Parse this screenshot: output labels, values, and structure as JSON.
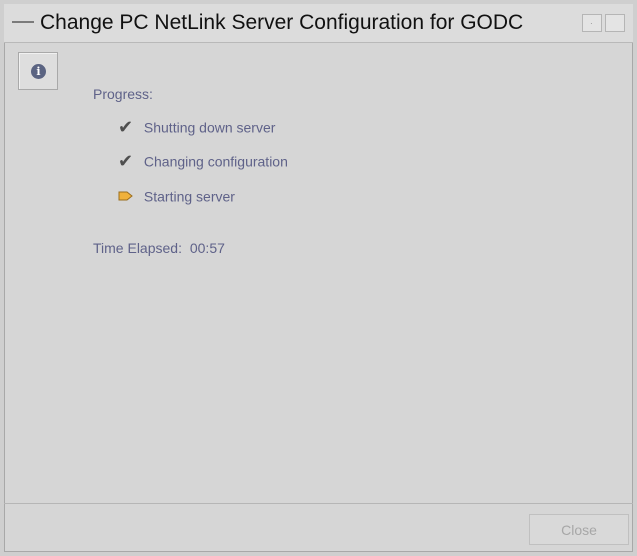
{
  "window": {
    "title": "Change PC NetLink Server Configuration for GODC"
  },
  "progress": {
    "label": "Progress:",
    "steps": [
      {
        "label": "Shutting down server",
        "status": "completed",
        "icon": "check-icon"
      },
      {
        "label": "Changing configuration",
        "status": "completed",
        "icon": "check-icon"
      },
      {
        "label": "Starting server",
        "status": "in-progress",
        "icon": "arrow-right-icon"
      }
    ],
    "time_elapsed_label": "Time Elapsed:",
    "time_elapsed_value": "00:57"
  },
  "buttons": {
    "close_label": "Close"
  },
  "colors": {
    "text_accent": "#5f6289",
    "in_progress_icon": "#f0b13b"
  }
}
